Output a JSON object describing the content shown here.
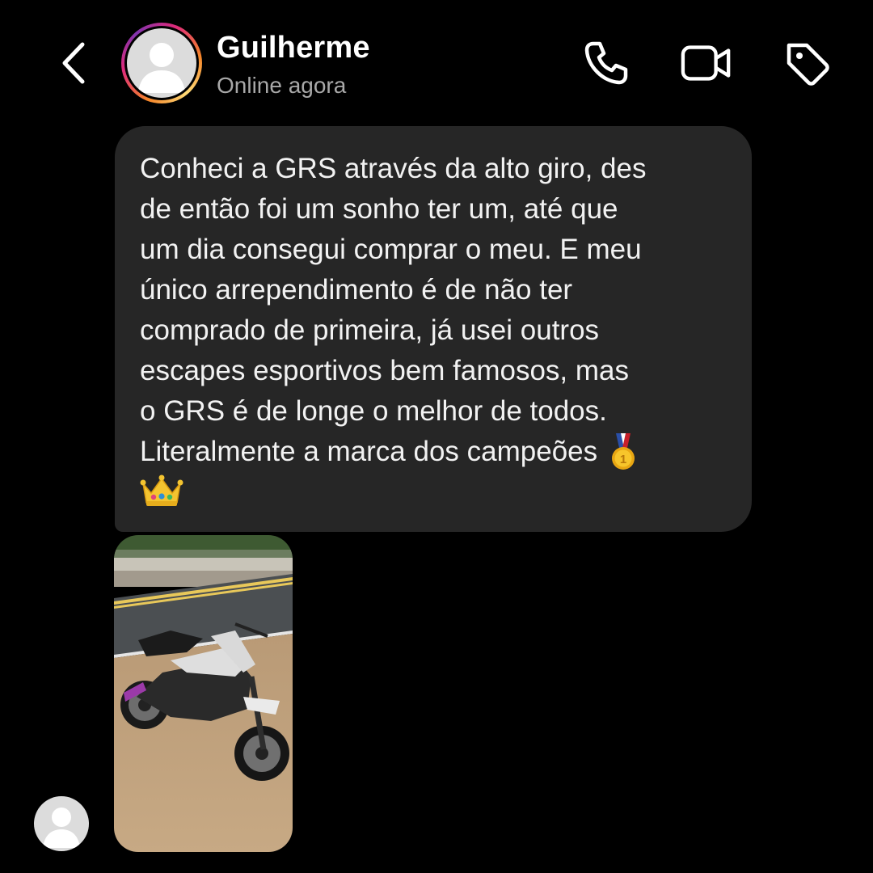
{
  "header": {
    "contact_name": "Guilherme",
    "status": "Online agora"
  },
  "icons": {
    "back": "chevron-left-icon",
    "call": "phone-icon",
    "video": "video-camera-icon",
    "tag": "tag-icon"
  },
  "message": {
    "lines": [
      "Conheci a GRS através da alto giro, des",
      "de então foi um sonho ter um, até que",
      "um dia consegui comprar o meu. E meu",
      "único arrependimento é de não ter",
      "comprado de primeira, já usei outros",
      "escapes esportivos bem famosos, mas",
      "o GRS é de longe o melhor de todos.",
      "Literalmente a marca dos campeões"
    ],
    "emojis": [
      "first-place-medal-emoji",
      "crown-emoji"
    ]
  },
  "attachment": {
    "type": "photo",
    "subject": "motorcycle"
  },
  "colors": {
    "background": "#000000",
    "bubble": "#262626",
    "text": "#f2f2f2",
    "status": "#a8a8a8"
  }
}
